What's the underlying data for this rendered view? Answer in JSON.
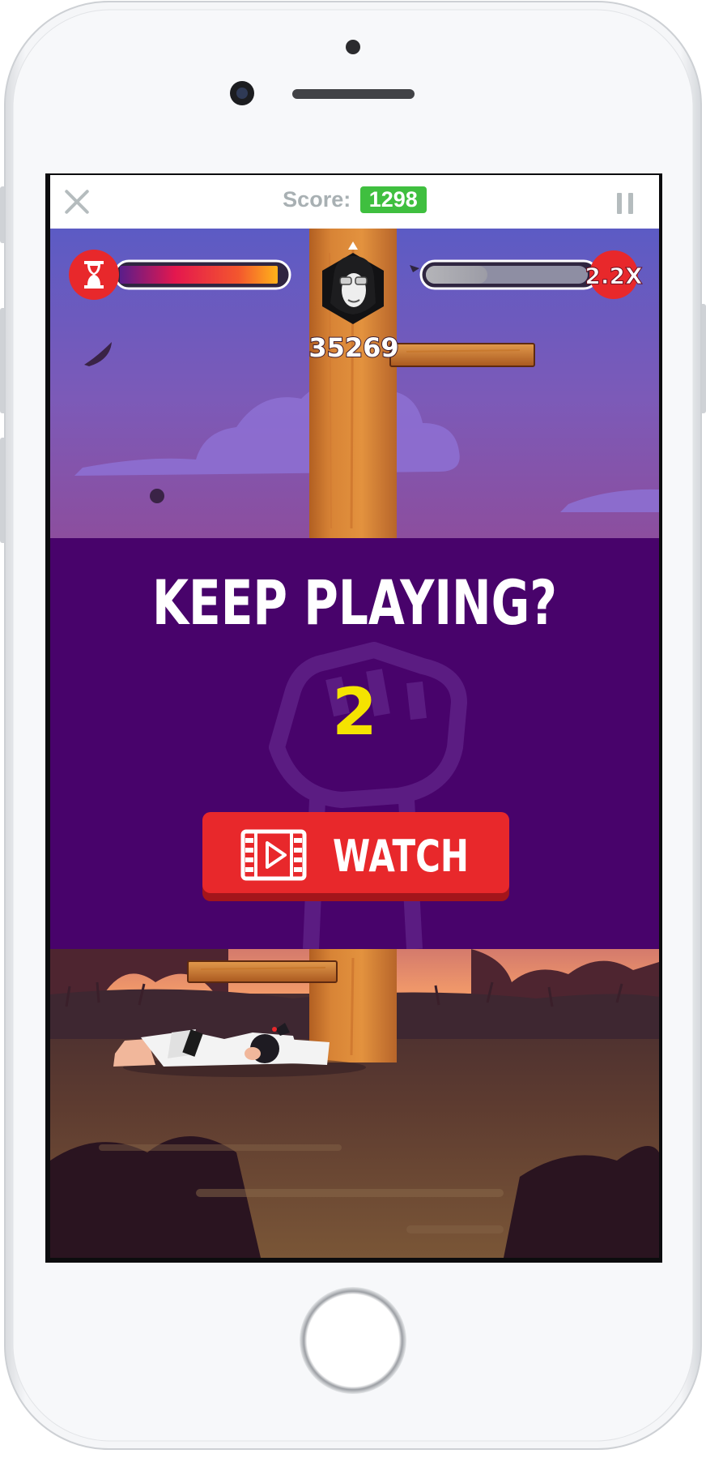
{
  "top_bar": {
    "score_label": "Score:",
    "score_value": "1298",
    "close_icon": "close-x-icon",
    "pause_icon": "pause-icon"
  },
  "hud": {
    "timer_icon": "hourglass-icon",
    "timer_fill": 0.93,
    "multiplier_fill": 0.38,
    "multiplier": "2.2X",
    "rival_score": "35269"
  },
  "overlay": {
    "title": "KEEP PLAYING?",
    "countdown": "2",
    "watch_label": "WATCH",
    "watch_icon": "film-play-icon",
    "background_icon": "raised-fist-icon"
  },
  "colors": {
    "overlay_bg": "#48036b",
    "button_red": "#e8282b",
    "score_green": "#3fbf3f",
    "countdown_yellow": "#f5e300"
  }
}
